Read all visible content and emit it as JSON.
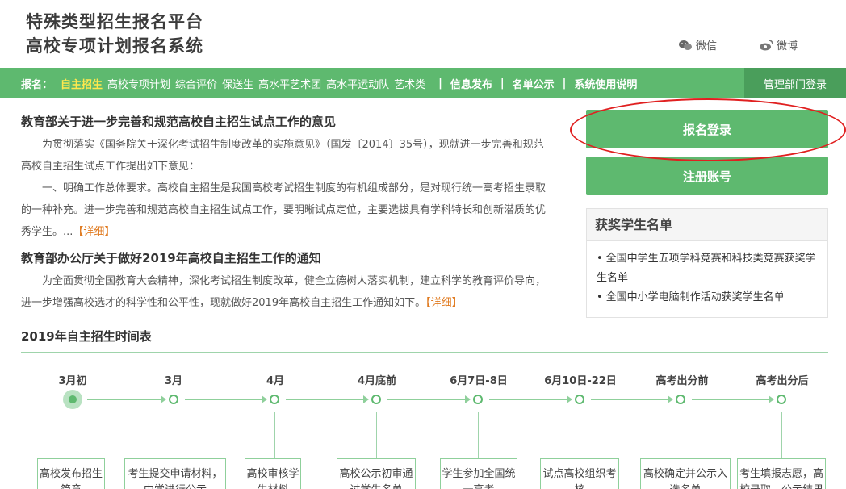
{
  "header": {
    "title_line1": "特殊类型招生报名平台",
    "title_line2": "高校专项计划报名系统",
    "wechat_label": "微信",
    "weibo_label": "微博",
    "wechat_icon": "wechat-icon",
    "weibo_icon": "weibo-icon"
  },
  "nav": {
    "lead": "报名：",
    "items": [
      "自主招生",
      "高校专项计划",
      "综合评价",
      "保送生",
      "高水平艺术团",
      "高水平运动队",
      "艺术类"
    ],
    "separator": "|",
    "info": "信息发布",
    "list": "名单公示",
    "guide": "系统使用说明",
    "admin": "管理部门登录",
    "accent": "#5eb96f",
    "active_color": "#ffe84d"
  },
  "articles": [
    {
      "title": "教育部关于进一步完善和规范高校自主招生试点工作的意见",
      "para1": "为贯彻落实《国务院关于深化考试招生制度改革的实施意见》（国发〔2014〕35号），现就进一步完善和规范高校自主招生试点工作提出如下意见：",
      "para2": "一、明确工作总体要求。高校自主招生是我国高校考试招生制度的有机组成部分，是对现行统一高考招生录取的一种补充。进一步完善和规范高校自主招生试点工作，要明晰试点定位，主要选拔具有学科特长和创新潜质的优秀学生。...",
      "more": "【详细】"
    },
    {
      "title": "教育部办公厅关于做好2019年高校自主招生工作的通知",
      "para1": "为全面贯彻全国教育大会精神，深化考试招生制度改革，健全立德树人落实机制，建立科学的教育评价导向，进一步增强高校选才的科学性和公平性，现就做好2019年高校自主招生工作通知如下。",
      "more": "【详细】"
    }
  ],
  "sidebar": {
    "login_button": "报名登录",
    "register_button": "注册账号",
    "box_title": "获奖学生名单",
    "box_items": [
      "全国中学生五项学科竞赛和科技类竞赛获奖学生名单",
      "全国中小学电脑制作活动获奖学生名单"
    ]
  },
  "timeline": {
    "title": "2019年自主招生时间表",
    "dates": [
      "3月初",
      "3月",
      "4月",
      "4月底前",
      "6月7日-8日",
      "6月10日-22日",
      "高考出分前",
      "高考出分后"
    ],
    "cards": [
      "高校发布招生简章",
      "考生提交申请材料，中学进行公示",
      "高校审核学生材料",
      "高校公示初审通过学生名单",
      "学生参加全国统一高考",
      "试点高校组织考核",
      "高校确定并公示入选名单",
      "考生填报志愿，高校录取，公示结果"
    ]
  }
}
